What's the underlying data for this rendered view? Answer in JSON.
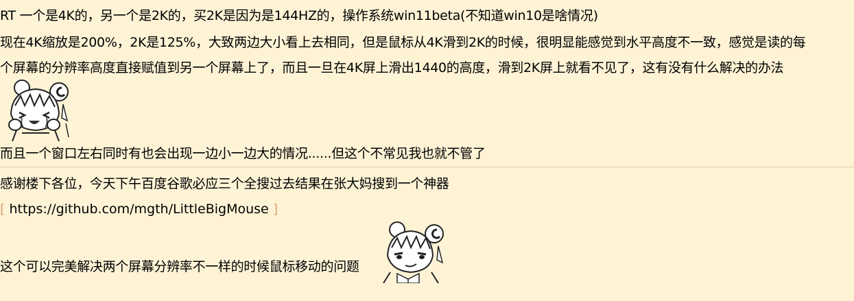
{
  "post1": {
    "line1": "RT 一个是4K的，另一个是2K的，买2K是因为是144HZ的，操作系统win11beta(不知道win10是啥情况)",
    "line2": "现在4K缩放是200%，2K是125%，大致两边大小看上去相同，但是鼠标从4K滑到2K的时候，很明显能感觉到水平高度不一致，感觉是读的每",
    "line3": "个屏幕的分辨率高度直接赋值到另一个屏幕上了，而且一旦在4K屏上滑出1440的高度，滑到2K屏上就看不见了，这有没有什么解决的办法",
    "line4": "而且一个窗口左右同时有也会出现一边小一边大的情况......但这个不常见我也就不管了",
    "emote_icon": "crying-anime-girl-icon"
  },
  "post2": {
    "line1": "感谢楼下各位，今天下午百度谷歌必应三个全搜过去结果在张大妈搜到一个神器",
    "link_open": "[",
    "link": "https://github.com/mgth/LittleBigMouse",
    "link_close": "]",
    "line2": "这个可以完美解决两个屏幕分辨率不一样的时候鼠标移动的问题",
    "emote_icon": "smug-anime-girl-icon"
  }
}
